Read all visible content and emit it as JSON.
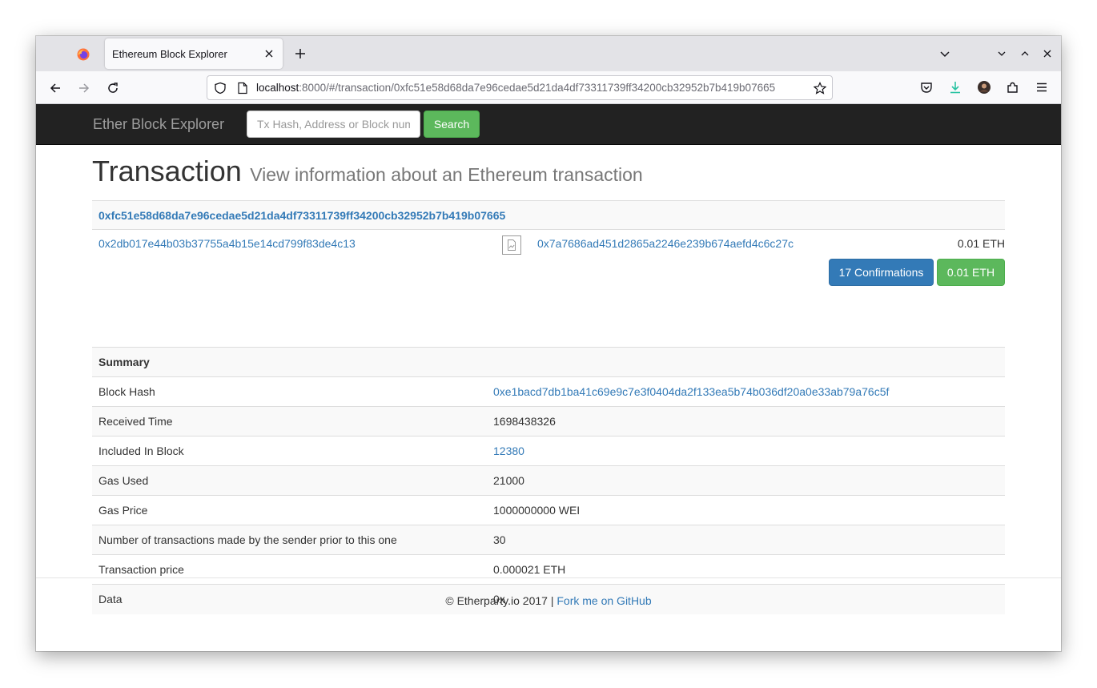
{
  "browser": {
    "tab_title": "Ethereum Block Explorer",
    "url_host": "localhost",
    "url_rest": ":8000/#/transaction/0xfc51e58d68da7e96cedae5d21da4df73311739ff34200cb32952b7b419b07665"
  },
  "site": {
    "brand": "Ether Block Explorer",
    "search_placeholder": "Tx Hash, Address or Block num",
    "search_button": "Search"
  },
  "header": {
    "title": "Transaction",
    "subtitle": "View information about an Ethereum transaction"
  },
  "transaction": {
    "hash": "0xfc51e58d68da7e96cedae5d21da4df73311739ff34200cb32952b7b419b07665",
    "from": "0x2db017e44b03b37755a4b15e14cd799f83de4c13",
    "to": "0x7a7686ad451d2865a2246e239b674aefd4c6c27c",
    "amount": "0.01 ETH",
    "confirmations_button": "17 Confirmations",
    "value_button": "0.01 ETH"
  },
  "summary": {
    "heading": "Summary",
    "rows": [
      {
        "label": "Block Hash",
        "value": "0xe1bacd7db1ba41c69e9c7e3f0404da2f133ea5b74b036df20a0e33ab79a76c5f"
      },
      {
        "label": "Received Time",
        "value": "1698438326"
      },
      {
        "label": "Included In Block",
        "value": "12380"
      },
      {
        "label": "Gas Used",
        "value": "21000"
      },
      {
        "label": "Gas Price",
        "value": "1000000000 WEI"
      },
      {
        "label": "Number of transactions made by the sender prior to this one",
        "value": "30"
      },
      {
        "label": "Transaction price",
        "value": "0.000021 ETH"
      },
      {
        "label": "Data",
        "value": "0x"
      }
    ]
  },
  "footer": {
    "copyright": "© Etherparty.io 2017 | ",
    "github_link": "Fork me on GitHub"
  },
  "colors": {
    "link": "#337ab7",
    "success": "#5cb85c",
    "navbar": "#222222"
  },
  "icons": [
    "firefox-logo",
    "close-icon",
    "plus-icon",
    "chevron-down-icon",
    "minimize-icon",
    "maximize-icon",
    "back-icon",
    "forward-icon",
    "reload-icon",
    "shield-icon",
    "page-icon",
    "star-icon",
    "pocket-icon",
    "download-icon",
    "account-avatar",
    "extensions-icon",
    "menu-icon",
    "broken-image-icon"
  ]
}
